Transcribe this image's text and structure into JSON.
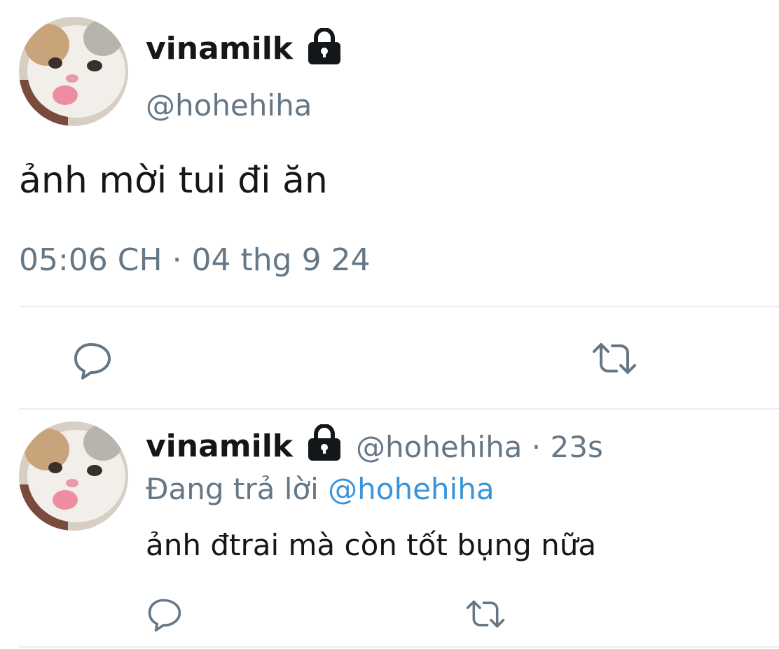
{
  "main_tweet": {
    "display_name": "vinamilk",
    "handle": "@hohehiha",
    "text": "ảnh mời tui đi ăn",
    "timestamp": "05:06 CH · 04 thg 9 24",
    "actions": [
      "reply-icon",
      "retweet-icon"
    ]
  },
  "reply_tweet": {
    "display_name": "vinamilk",
    "handle": "@hohehiha",
    "separator": "·",
    "age": "23s",
    "replying_to_label": "Đang trả lời",
    "replying_to_handle": "@hohehiha",
    "text": "ảnh đtrai mà còn tốt bụng nữa",
    "actions": [
      "reply-icon",
      "retweet-icon"
    ]
  },
  "colors": {
    "text_primary": "#14171a",
    "text_secondary": "#657786",
    "link": "#3b94d9",
    "divider": "#e6ecf0"
  }
}
